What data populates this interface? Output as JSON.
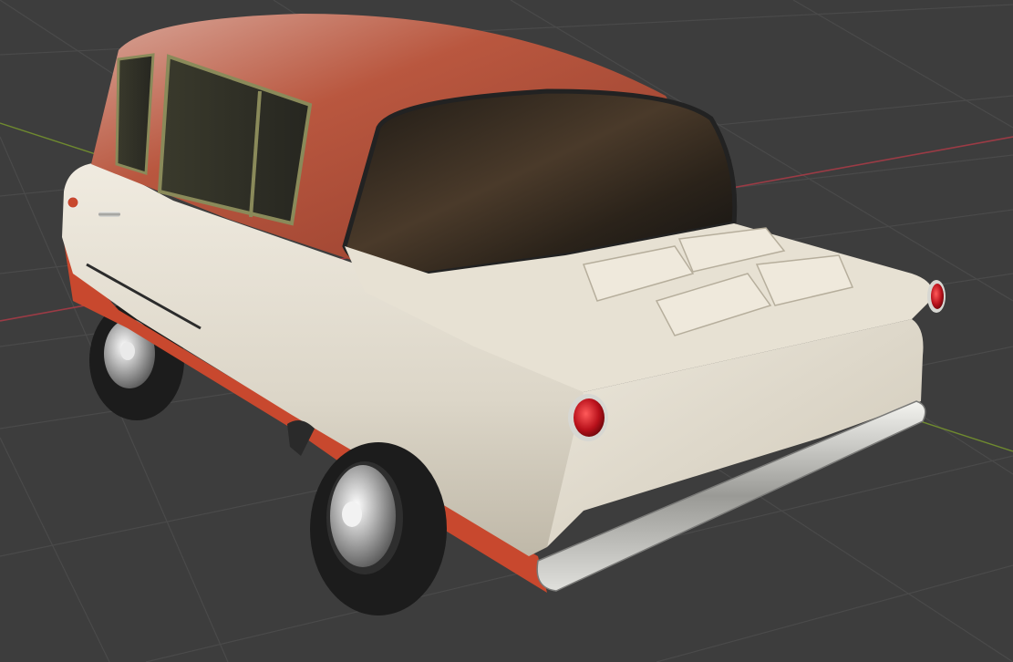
{
  "viewport": {
    "background": "#3d3d3d",
    "grid_color": "#4a4a4a",
    "x_axis_color": "#9b3b45",
    "y_axis_color": "#6f8a2f"
  },
  "car": {
    "body_lower_color": "#e6e0d2",
    "body_accent_color": "#c8482e",
    "roof_color": "#b9573f",
    "glass_color": "#2a241c",
    "chrome_color": "#cfd0cc",
    "tire_color": "#1c1c1c",
    "tail_light_color": "#b8111b"
  }
}
